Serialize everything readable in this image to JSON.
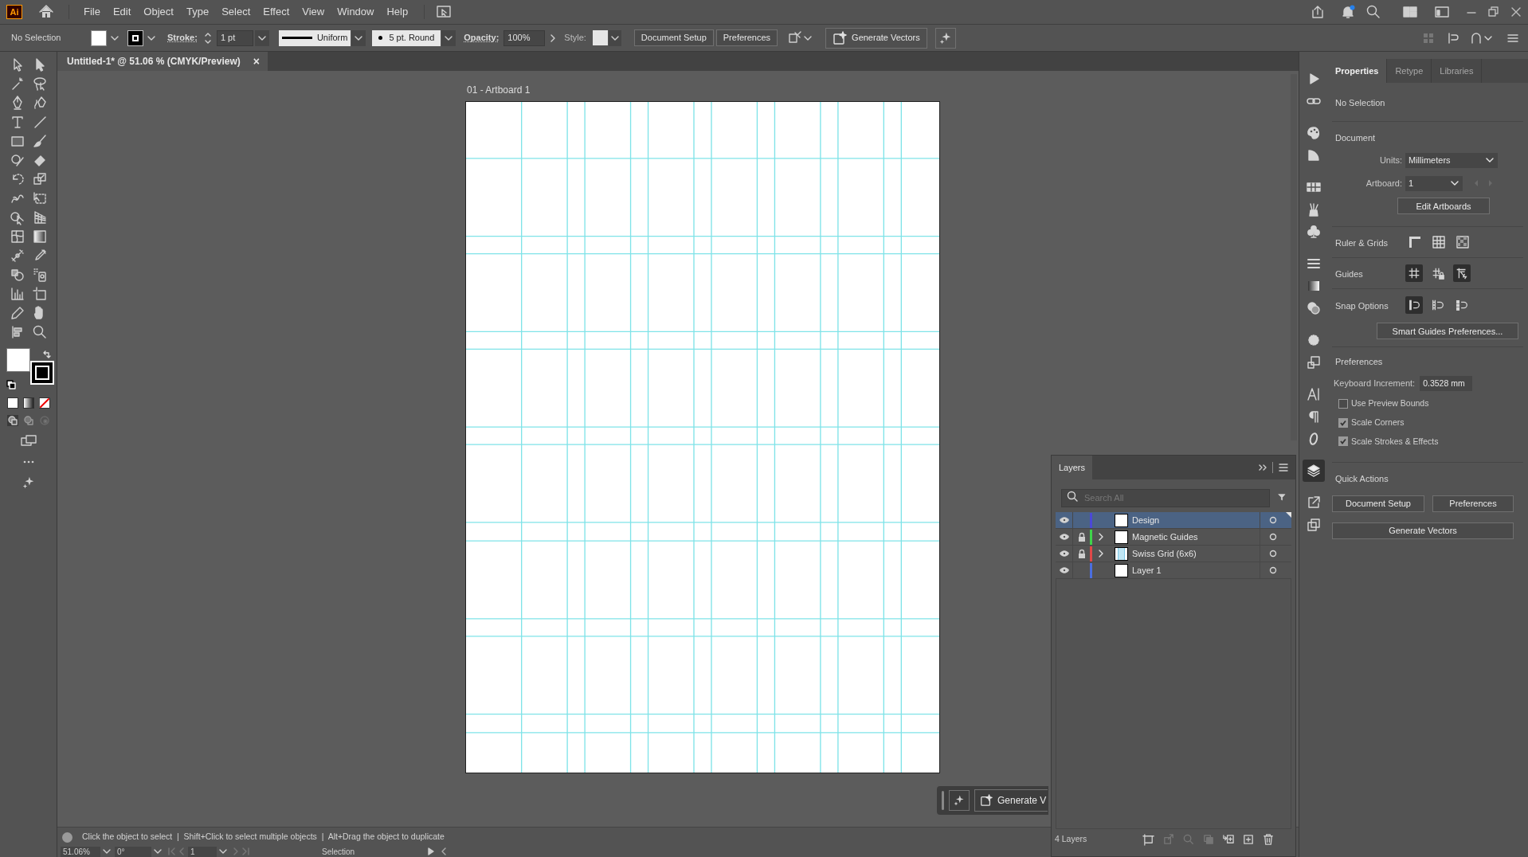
{
  "app": {
    "logo": "Ai"
  },
  "menu": [
    "File",
    "Edit",
    "Object",
    "Type",
    "Select",
    "Effect",
    "View",
    "Window",
    "Help"
  ],
  "control_bar": {
    "selection": "No Selection",
    "stroke_label": "Stroke:",
    "stroke_weight": "1 pt",
    "stroke_profile": "Uniform",
    "brush": "5 pt. Round",
    "opacity_label": "Opacity:",
    "opacity": "100%",
    "style_label": "Style:",
    "buttons": [
      "Document Setup",
      "Preferences"
    ],
    "generate": "Generate Vectors"
  },
  "document_tab": {
    "title": "Untitled-1* @ 51.06 % (CMYK/Preview)",
    "close": "×"
  },
  "artboard": {
    "label": "01 - Artboard 1"
  },
  "floating_bar": {
    "label": "Generate V"
  },
  "status": {
    "hint": "Click the object to select  |  Shift+Click to select multiple objects  |  Alt+Drag the object to duplicate"
  },
  "bottom_bar": {
    "zoom": "51.06%",
    "rotation": "0°",
    "artboard": "1",
    "tool": "Selection"
  },
  "properties": {
    "tabs": [
      {
        "label": "Properties",
        "selected": true
      },
      {
        "label": "Retype",
        "selected": false
      },
      {
        "label": "Libraries",
        "selected": false
      }
    ],
    "selection": "No Selection",
    "document": {
      "heading": "Document",
      "units_label": "Units:",
      "units": "Millimeters",
      "artboard_label": "Artboard:",
      "artboard": "1",
      "edit_button": "Edit Artboards"
    },
    "ruler_grids": {
      "heading": "Ruler & Grids"
    },
    "guides": {
      "heading": "Guides",
      "toggles": [
        {
          "kind": "show",
          "on": true
        },
        {
          "kind": "lock",
          "on": false
        },
        {
          "kind": "smart",
          "on": true
        }
      ]
    },
    "snap": {
      "heading": "Snap Options",
      "toggles": [
        {
          "kind": "point",
          "on": true
        },
        {
          "kind": "grid",
          "on": false
        },
        {
          "kind": "pixel",
          "on": false
        }
      ],
      "button": "Smart Guides Preferences..."
    },
    "preferences": {
      "heading": "Preferences",
      "increment_label": "Keyboard Increment:",
      "increment": "0.3528 mm",
      "checkboxes": [
        {
          "label": "Use Preview Bounds",
          "checked": false
        },
        {
          "label": "Scale Corners",
          "checked": true
        },
        {
          "label": "Scale Strokes & Effects",
          "checked": true
        }
      ]
    },
    "quick_actions": {
      "heading": "Quick Actions",
      "buttons": [
        "Document Setup",
        "Preferences",
        "Generate Vectors"
      ]
    }
  },
  "layers": {
    "title": "Layers",
    "search_placeholder": "Search All",
    "count": "4 Layers",
    "items": [
      {
        "name": "Design",
        "color": "#4b48d8",
        "visible": true,
        "locked": false,
        "expandable": false,
        "selected": true,
        "grid_thumbnail": false
      },
      {
        "name": "Magnetic Guides",
        "color": "#3fd44a",
        "visible": true,
        "locked": true,
        "expandable": true,
        "selected": false,
        "grid_thumbnail": false
      },
      {
        "name": "Swiss Grid (6x6)",
        "color": "#e04848",
        "visible": true,
        "locked": true,
        "expandable": true,
        "selected": false,
        "grid_thumbnail": true
      },
      {
        "name": "Layer 1",
        "color": "#4a6ee0",
        "visible": true,
        "locked": false,
        "expandable": false,
        "selected": false,
        "grid_thumbnail": false
      }
    ]
  }
}
